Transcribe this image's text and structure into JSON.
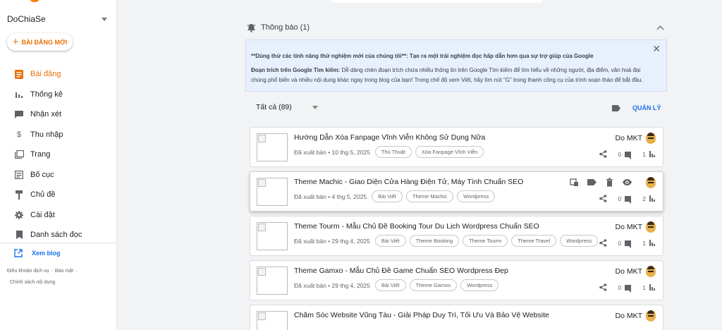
{
  "sidebar": {
    "blog_name": "DoChiaSe",
    "new_post_label": "BÀI ĐĂNG MỚI",
    "items": [
      {
        "label": "Bài đăng",
        "icon": "posts-icon",
        "active": true
      },
      {
        "label": "Thống kê",
        "icon": "stats-icon"
      },
      {
        "label": "Nhận xét",
        "icon": "comment-icon"
      },
      {
        "label": "Thu nhập",
        "icon": "dollar-icon"
      },
      {
        "label": "Trang",
        "icon": "pages-icon"
      },
      {
        "label": "Bố cục",
        "icon": "layout-icon"
      },
      {
        "label": "Chủ đề",
        "icon": "paint-roller-icon"
      },
      {
        "label": "Cài đặt",
        "icon": "gear-icon"
      },
      {
        "label": "Danh sách đọc",
        "icon": "bookmark-icon"
      }
    ],
    "view_blog_label": "Xem blog",
    "footer": {
      "terms": "Điều khoản dịch vụ",
      "privacy": "Bảo mật",
      "content_policy": "Chính sách nội dung",
      "separator": "·"
    }
  },
  "notification": {
    "title": "Thông báo (1)",
    "line1": "**Dùng thử các tính năng thử nghiệm mới của chúng tôi**: Tạo ra một trải nghiệm đọc hấp dẫn hơn qua sự trợ giúp của Google",
    "line2_bold": "Đoạn trích trên Google Tìm kiếm:",
    "line2_rest": " Dễ dàng chèn đoạn trích chứa nhiều thông tin trên Google Tìm kiếm để tìm hiểu về những người, địa điểm, văn hoá đại chúng phổ biến và nhiều nội dung khác ngay trong blog của bạn! Trong chế độ xem Viết, hãy tìm nút \"G\" trong thanh công cụ của trình soạn thảo để bắt đầu."
  },
  "filter": {
    "selected": "Tất cả (89)",
    "manage_label": "QUẢN LÝ"
  },
  "posts": [
    {
      "title": "Hướng Dẫn Xóa Fanpage Vĩnh Viễn Không Sử Dụng Nữa",
      "status": "Đã xuất bản • 10 thg 5, 2025",
      "labels": [
        "Thủ Thuật",
        "Xóa Fanpage Vĩnh Viễn"
      ],
      "author": "Do MKT",
      "comments": "0",
      "views": "1"
    },
    {
      "title": "Theme Machic - Giao Diện Cửa Hàng Điện Tử, Máy Tính Chuẩn SEO",
      "status": "Đã xuất bản • 4 thg 5, 2025",
      "labels": [
        "Bài Viết",
        "Theme Machic",
        "Wordpress"
      ],
      "author": "",
      "comments": "0",
      "views": "2"
    },
    {
      "title": "Theme Tourm - Mẫu Chủ Đề Booking Tour Du Lịch Wordpress Chuẩn SEO",
      "status": "Đã xuất bản • 29 thg 4, 2025",
      "labels": [
        "Bài Viết",
        "Theme Booking",
        "Theme Tourm",
        "Theme Travel",
        "Wordpress"
      ],
      "author": "Do MKT",
      "comments": "0",
      "views": "1"
    },
    {
      "title": "Theme Gamxo - Mẫu Chủ Đề Game Chuẩn SEO Wordpress Đẹp",
      "status": "Đã xuất bản • 29 thg 4, 2025",
      "labels": [
        "Bài Viết",
        "Theme Gamxo",
        "Wordpress"
      ],
      "author": "Do MKT",
      "comments": "0",
      "views": "1"
    },
    {
      "title": "Chăm Sóc Website Vũng Tàu - Giải Pháp Duy Trì, Tối Ưu Và Bảo Vệ Website",
      "status": "",
      "labels": [],
      "author": "Do MKT",
      "comments": "",
      "views": ""
    }
  ],
  "colors": {
    "accent": "#e8710a",
    "link": "#1a73e8",
    "notice_bg": "#e8f0fe"
  }
}
